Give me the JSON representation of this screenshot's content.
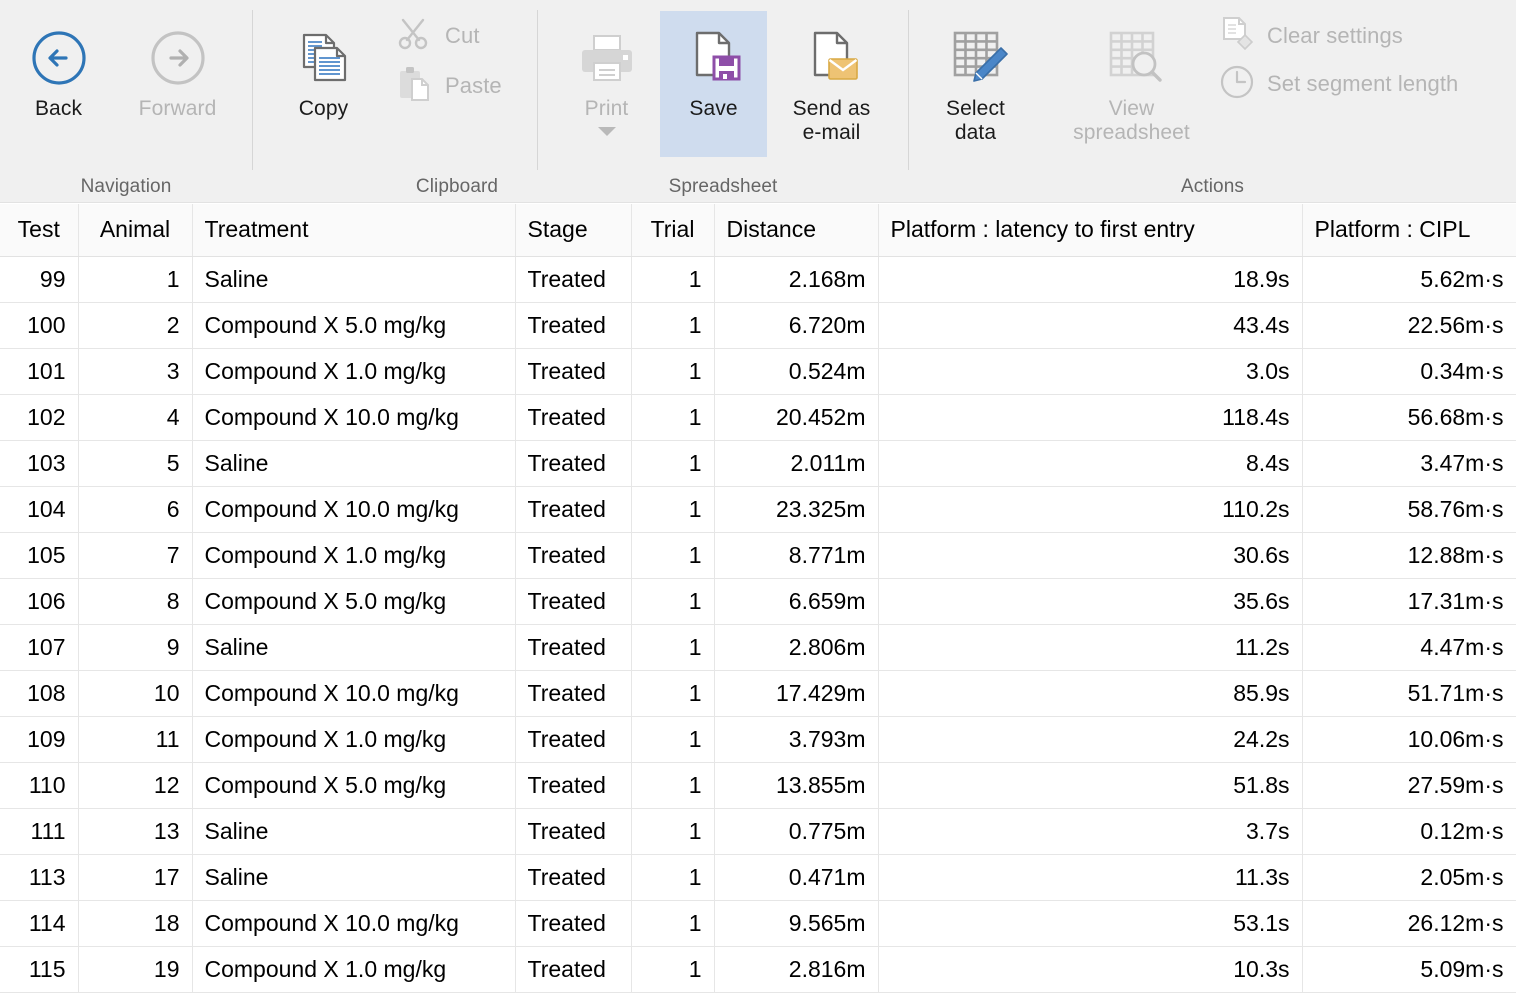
{
  "ribbon": {
    "groups": [
      {
        "label": "Navigation"
      },
      {
        "label": "Clipboard"
      },
      {
        "label": "Spreadsheet"
      },
      {
        "label": "Actions"
      }
    ],
    "buttons": {
      "back": "Back",
      "forward": "Forward",
      "copy": "Copy",
      "cut": "Cut",
      "paste": "Paste",
      "print": "Print",
      "save": "Save",
      "send_as_email_line1": "Send as",
      "send_as_email_line2": "e-mail",
      "select_data_line1": "Select",
      "select_data_line2": "data",
      "view_spreadsheet_line1": "View",
      "view_spreadsheet_line2": "spreadsheet",
      "clear_settings": "Clear settings",
      "set_segment_length": "Set segment length"
    },
    "colors": {
      "toolbar_bg": "#f0f0f0",
      "selected_bg": "#cfdcee",
      "accent_blue": "#2e75b6",
      "disabled_text": "#b5b5b5",
      "save_icon_purple": "#8e4ea8",
      "email_icon_tan": "#eec374",
      "grid_icon_gray": "#a0a0a0"
    }
  },
  "table": {
    "columns": [
      "Test",
      "Animal",
      "Treatment",
      "Stage",
      "Trial",
      "Distance",
      "Platform : latency to first entry",
      "Platform : CIPL"
    ],
    "rows": [
      [
        "99",
        "1",
        "Saline",
        "Treated",
        "1",
        "2.168m",
        "18.9s",
        "5.62m·s"
      ],
      [
        "100",
        "2",
        "Compound X 5.0 mg/kg",
        "Treated",
        "1",
        "6.720m",
        "43.4s",
        "22.56m·s"
      ],
      [
        "101",
        "3",
        "Compound X 1.0 mg/kg",
        "Treated",
        "1",
        "0.524m",
        "3.0s",
        "0.34m·s"
      ],
      [
        "102",
        "4",
        "Compound X 10.0 mg/kg",
        "Treated",
        "1",
        "20.452m",
        "118.4s",
        "56.68m·s"
      ],
      [
        "103",
        "5",
        "Saline",
        "Treated",
        "1",
        "2.011m",
        "8.4s",
        "3.47m·s"
      ],
      [
        "104",
        "6",
        "Compound X 10.0 mg/kg",
        "Treated",
        "1",
        "23.325m",
        "110.2s",
        "58.76m·s"
      ],
      [
        "105",
        "7",
        "Compound X 1.0 mg/kg",
        "Treated",
        "1",
        "8.771m",
        "30.6s",
        "12.88m·s"
      ],
      [
        "106",
        "8",
        "Compound X 5.0 mg/kg",
        "Treated",
        "1",
        "6.659m",
        "35.6s",
        "17.31m·s"
      ],
      [
        "107",
        "9",
        "Saline",
        "Treated",
        "1",
        "2.806m",
        "11.2s",
        "4.47m·s"
      ],
      [
        "108",
        "10",
        "Compound X 10.0 mg/kg",
        "Treated",
        "1",
        "17.429m",
        "85.9s",
        "51.71m·s"
      ],
      [
        "109",
        "11",
        "Compound X 1.0 mg/kg",
        "Treated",
        "1",
        "3.793m",
        "24.2s",
        "10.06m·s"
      ],
      [
        "110",
        "12",
        "Compound X 5.0 mg/kg",
        "Treated",
        "1",
        "13.855m",
        "51.8s",
        "27.59m·s"
      ],
      [
        "111",
        "13",
        "Saline",
        "Treated",
        "1",
        "0.775m",
        "3.7s",
        "0.12m·s"
      ],
      [
        "113",
        "17",
        "Saline",
        "Treated",
        "1",
        "0.471m",
        "11.3s",
        "2.05m·s"
      ],
      [
        "114",
        "18",
        "Compound X 10.0 mg/kg",
        "Treated",
        "1",
        "9.565m",
        "53.1s",
        "26.12m·s"
      ],
      [
        "115",
        "19",
        "Compound X 1.0 mg/kg",
        "Treated",
        "1",
        "2.816m",
        "10.3s",
        "5.09m·s"
      ]
    ]
  }
}
